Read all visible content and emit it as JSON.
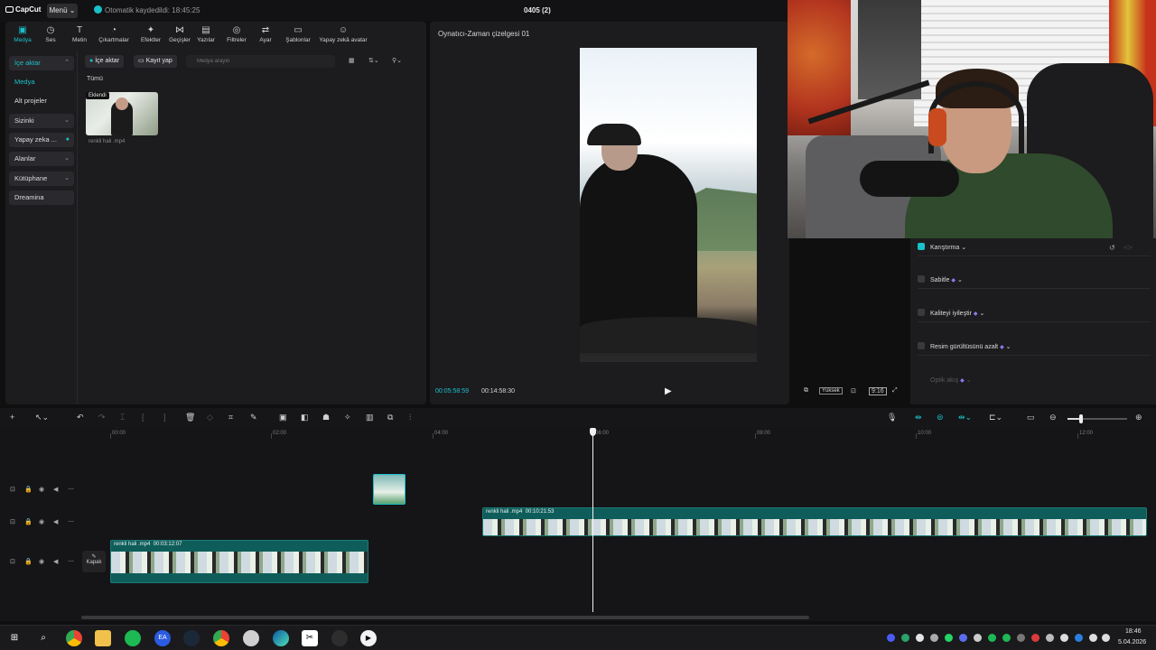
{
  "titlebar": {
    "logo": "CapCut",
    "menu_label": "Menü",
    "autosave": "Otomatik kaydedildi: 18:45:25",
    "project_title": "0405 (2)"
  },
  "categories": [
    {
      "label": "Medya",
      "icon": "media-icon"
    },
    {
      "label": "Ses",
      "icon": "audio-icon"
    },
    {
      "label": "Metin",
      "icon": "text-icon"
    },
    {
      "label": "Çıkartmalar",
      "icon": "sticker-icon"
    },
    {
      "label": "Efektler",
      "icon": "effects-icon"
    },
    {
      "label": "Geçişler",
      "icon": "transitions-icon"
    },
    {
      "label": "Yazılar",
      "icon": "captions-icon"
    },
    {
      "label": "Filtreler",
      "icon": "filters-icon"
    },
    {
      "label": "Ayar",
      "icon": "adjust-icon"
    },
    {
      "label": "Şablonlar",
      "icon": "templates-icon"
    },
    {
      "label": "Yapay zekâ avatar",
      "icon": "ai-avatar-icon"
    }
  ],
  "sidebar": {
    "items": [
      {
        "label": "İçe aktar"
      },
      {
        "label": "Medya"
      },
      {
        "label": "Alt projeler"
      },
      {
        "label": "Sizinki"
      },
      {
        "label": "Yapay zeka ..."
      },
      {
        "label": "Alanlar"
      },
      {
        "label": "Kütüphane"
      },
      {
        "label": "Dreamina"
      }
    ]
  },
  "media": {
    "import_label": "İçe aktar",
    "record_label": "Kayıt yap",
    "search_placeholder": "Medya arayın",
    "all_label": "Tümü",
    "thumb_badge": "Eklendi",
    "thumb_name": "renkli hali .mp4"
  },
  "player": {
    "title": "Oynatıcı-Zaman çizelgesi 01",
    "current_time": "00:05:58:59",
    "total_time": "00:14:58:30",
    "quality": "Yüksek",
    "ratio": "9:16"
  },
  "props": {
    "items": [
      {
        "label": "Karıştırma",
        "checked": true
      },
      {
        "label": "Sabitle",
        "checked": false
      },
      {
        "label": "Kaliteyi iyileştir",
        "checked": false
      },
      {
        "label": "Resim gürültüsünü azalt",
        "checked": false
      },
      {
        "label": "Optik akış",
        "checked": false
      }
    ]
  },
  "timeline": {
    "ruler": [
      "00:00",
      "02:00",
      "04:00",
      "06:00",
      "08:00",
      "10:00",
      "12:00"
    ],
    "clips": [
      {
        "label": "renkli hali .mp4",
        "duration": "00:10:21:53"
      },
      {
        "label": "renkli hali .mp4",
        "duration": "00:03:12:07"
      }
    ],
    "cover_label": "Kapak"
  },
  "taskbar": {
    "apps": [
      "windows-start-icon",
      "search-icon",
      "chrome-icon",
      "file-explorer-icon",
      "spotify-icon",
      "ea-icon",
      "steam-icon",
      "chrome-profile-icon",
      "chrome-alt-icon",
      "edge-icon",
      "capcut-icon",
      "obs-icon",
      "media-player-icon"
    ],
    "time": "18:46",
    "date": "5.04.2026"
  }
}
